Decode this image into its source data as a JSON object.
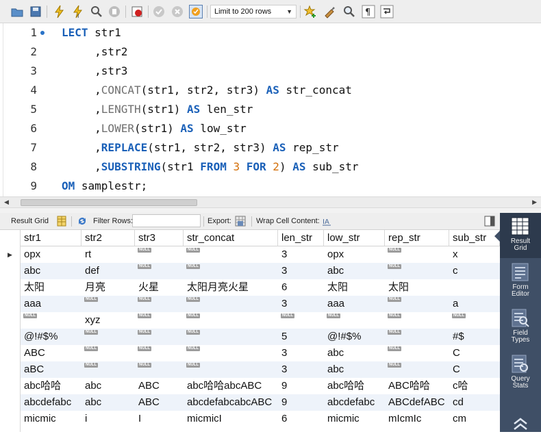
{
  "toolbar": {
    "limit_label": "Limit to 200 rows",
    "icons": [
      "open-folder-icon",
      "save-icon",
      "execute-icon",
      "execute-current-icon",
      "explain-icon",
      "stop-icon",
      "toggle-error-icon",
      "commit-icon",
      "rollback-icon",
      "autocommit-icon",
      "beautify-icon",
      "brush-icon",
      "find-icon",
      "invisible-chars-icon",
      "wrap-icon"
    ]
  },
  "editor": {
    "lines": [
      {
        "num": "1",
        "tokens": [
          {
            "t": "LECT",
            "c": "kw"
          },
          {
            "t": " str1",
            "c": ""
          }
        ]
      },
      {
        "num": "2",
        "tokens": [
          {
            "t": "     ,str2",
            "c": ""
          }
        ]
      },
      {
        "num": "3",
        "tokens": [
          {
            "t": "     ,str3",
            "c": ""
          }
        ]
      },
      {
        "num": "4",
        "tokens": [
          {
            "t": "     ,",
            "c": ""
          },
          {
            "t": "CONCAT",
            "c": "fn"
          },
          {
            "t": "(str1, str2, str3) ",
            "c": ""
          },
          {
            "t": "AS",
            "c": "kw"
          },
          {
            "t": " str_concat",
            "c": ""
          }
        ]
      },
      {
        "num": "5",
        "tokens": [
          {
            "t": "     ,",
            "c": ""
          },
          {
            "t": "LENGTH",
            "c": "fn"
          },
          {
            "t": "(str1) ",
            "c": ""
          },
          {
            "t": "AS",
            "c": "kw"
          },
          {
            "t": " len_str",
            "c": ""
          }
        ]
      },
      {
        "num": "6",
        "tokens": [
          {
            "t": "     ,",
            "c": ""
          },
          {
            "t": "LOWER",
            "c": "fn"
          },
          {
            "t": "(str1) ",
            "c": ""
          },
          {
            "t": "AS",
            "c": "kw"
          },
          {
            "t": " low_str",
            "c": ""
          }
        ]
      },
      {
        "num": "7",
        "tokens": [
          {
            "t": "     ,",
            "c": ""
          },
          {
            "t": "REPLACE",
            "c": "kw"
          },
          {
            "t": "(str1, str2, str3) ",
            "c": ""
          },
          {
            "t": "AS",
            "c": "kw"
          },
          {
            "t": " rep_str",
            "c": ""
          }
        ]
      },
      {
        "num": "8",
        "tokens": [
          {
            "t": "     ,",
            "c": ""
          },
          {
            "t": "SUBSTRING",
            "c": "kw"
          },
          {
            "t": "(str1 ",
            "c": ""
          },
          {
            "t": "FROM",
            "c": "kw"
          },
          {
            "t": " ",
            "c": ""
          },
          {
            "t": "3",
            "c": "num"
          },
          {
            "t": " ",
            "c": ""
          },
          {
            "t": "FOR",
            "c": "kw"
          },
          {
            "t": " ",
            "c": ""
          },
          {
            "t": "2",
            "c": "num"
          },
          {
            "t": ") ",
            "c": ""
          },
          {
            "t": "AS",
            "c": "kw"
          },
          {
            "t": " sub_str",
            "c": ""
          }
        ]
      },
      {
        "num": "9",
        "tokens": [
          {
            "t": "OM",
            "c": "kw"
          },
          {
            "t": " samplestr;",
            "c": ""
          }
        ]
      }
    ]
  },
  "result_toolbar": {
    "result_grid_label": "Result Grid",
    "filter_rows_label": "Filter Rows:",
    "filter_rows_value": "",
    "export_label": "Export:",
    "wrap_label": "Wrap Cell Content:"
  },
  "grid": {
    "null_label": "NULL",
    "columns": [
      "str1",
      "str2",
      "str3",
      "str_concat",
      "len_str",
      "low_str",
      "rep_str",
      "sub_str"
    ],
    "rows": [
      [
        "opx",
        "rt",
        null,
        null,
        "3",
        "opx",
        null,
        "x"
      ],
      [
        "abc",
        "def",
        null,
        null,
        "3",
        "abc",
        null,
        "c"
      ],
      [
        "太阳",
        "月亮",
        "火星",
        "太阳月亮火星",
        "6",
        "太阳",
        "太阳",
        ""
      ],
      [
        "aaa",
        null,
        null,
        null,
        "3",
        "aaa",
        null,
        "a"
      ],
      [
        null,
        "xyz",
        null,
        null,
        null,
        null,
        null,
        null
      ],
      [
        "@!#$%",
        null,
        null,
        null,
        "5",
        "@!#$%",
        null,
        "#$"
      ],
      [
        "ABC",
        null,
        null,
        null,
        "3",
        "abc",
        null,
        "C"
      ],
      [
        "aBC",
        null,
        null,
        null,
        "3",
        "abc",
        null,
        "C"
      ],
      [
        "abc哈哈",
        "abc",
        "ABC",
        "abc哈哈abcABC",
        "9",
        "abc哈哈",
        "ABC哈哈",
        "c哈"
      ],
      [
        "abcdefabc",
        "abc",
        "ABC",
        "abcdefabcabcABC",
        "9",
        "abcdefabc",
        "ABCdefABC",
        "cd"
      ],
      [
        "micmic",
        "i",
        "I",
        "micmicI",
        "6",
        "micmic",
        "mIcmIc",
        "cm"
      ]
    ]
  },
  "side_panel": {
    "buttons": [
      {
        "label": "Result Grid",
        "icon": "result-grid-icon"
      },
      {
        "label": "Form Editor",
        "icon": "form-editor-icon"
      },
      {
        "label": "Field Types",
        "icon": "field-types-icon"
      },
      {
        "label": "Query Stats",
        "icon": "query-stats-icon"
      }
    ]
  }
}
